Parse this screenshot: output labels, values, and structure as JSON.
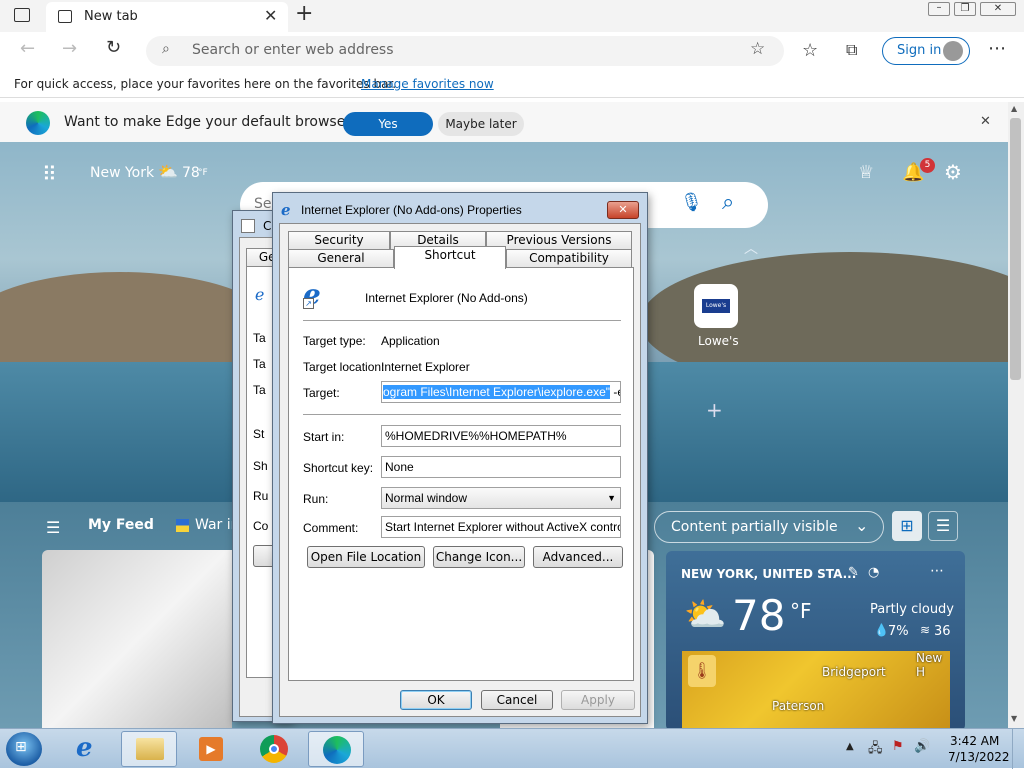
{
  "browser": {
    "tab_title": "New tab",
    "address_placeholder": "Search or enter web address",
    "signin_label": "Sign in",
    "favbar_text": "For quick access, place your favorites here on the favorites bar.",
    "favbar_link": "Manage favorites now",
    "infobar_text": "Want to make Edge your default browser?",
    "infobar_yes": "Yes",
    "infobar_later": "Maybe later"
  },
  "ntp": {
    "location": "New York",
    "temp": "78",
    "temp_unit": "°F",
    "notif_count": "5",
    "search_partial": "Se",
    "quicklink_label": "Lowe's",
    "quicklink_logo": "Lowe's",
    "feed_label": "My Feed",
    "feed_tab": "War in",
    "content_dropdown": "Content partially visible",
    "weather": {
      "location": "NEW YORK, UNITED STA...",
      "temp": "78",
      "unit": "°F",
      "condition": "Partly cloudy",
      "precip": "7%",
      "aqi": "36",
      "map_city1": "Bridgeport",
      "map_city2": "Paterson",
      "map_city3": "New H"
    }
  },
  "backdlg": {
    "title_partial": "C",
    "tab_partial": "Gen",
    "labels": [
      "Ta",
      "Ta",
      "Ta",
      "St",
      "Sh",
      "Ru",
      "Co"
    ]
  },
  "dialog": {
    "title": "Internet Explorer (No Add-ons) Properties",
    "tabs_top": [
      "Security",
      "Details",
      "Previous Versions"
    ],
    "tabs_bottom": [
      "General",
      "Shortcut",
      "Compatibility"
    ],
    "app_name": "Internet Explorer (No Add-ons)",
    "target_type_label": "Target type:",
    "target_type_value": "Application",
    "target_location_label": "Target location:",
    "target_location_value": "Internet Explorer",
    "target_label": "Target:",
    "target_value_selected": "ogram Files\\Internet Explorer\\iexplore.exe\"",
    "target_value_rest": " -extoff",
    "startin_label": "Start in:",
    "startin_value": "%HOMEDRIVE%%HOMEPATH%",
    "shortcut_label": "Shortcut key:",
    "shortcut_value": "None",
    "run_label": "Run:",
    "run_value": "Normal window",
    "comment_label": "Comment:",
    "comment_value": "Start Internet Explorer without ActiveX controls or",
    "btn_open": "Open File Location",
    "btn_icon": "Change Icon...",
    "btn_adv": "Advanced...",
    "ok": "OK",
    "cancel": "Cancel",
    "apply": "Apply"
  },
  "taskbar": {
    "time": "3:42 AM",
    "date": "7/13/2022"
  },
  "colors": {
    "edge_blue": "#0f6cbd",
    "selection": "#3399ff"
  }
}
